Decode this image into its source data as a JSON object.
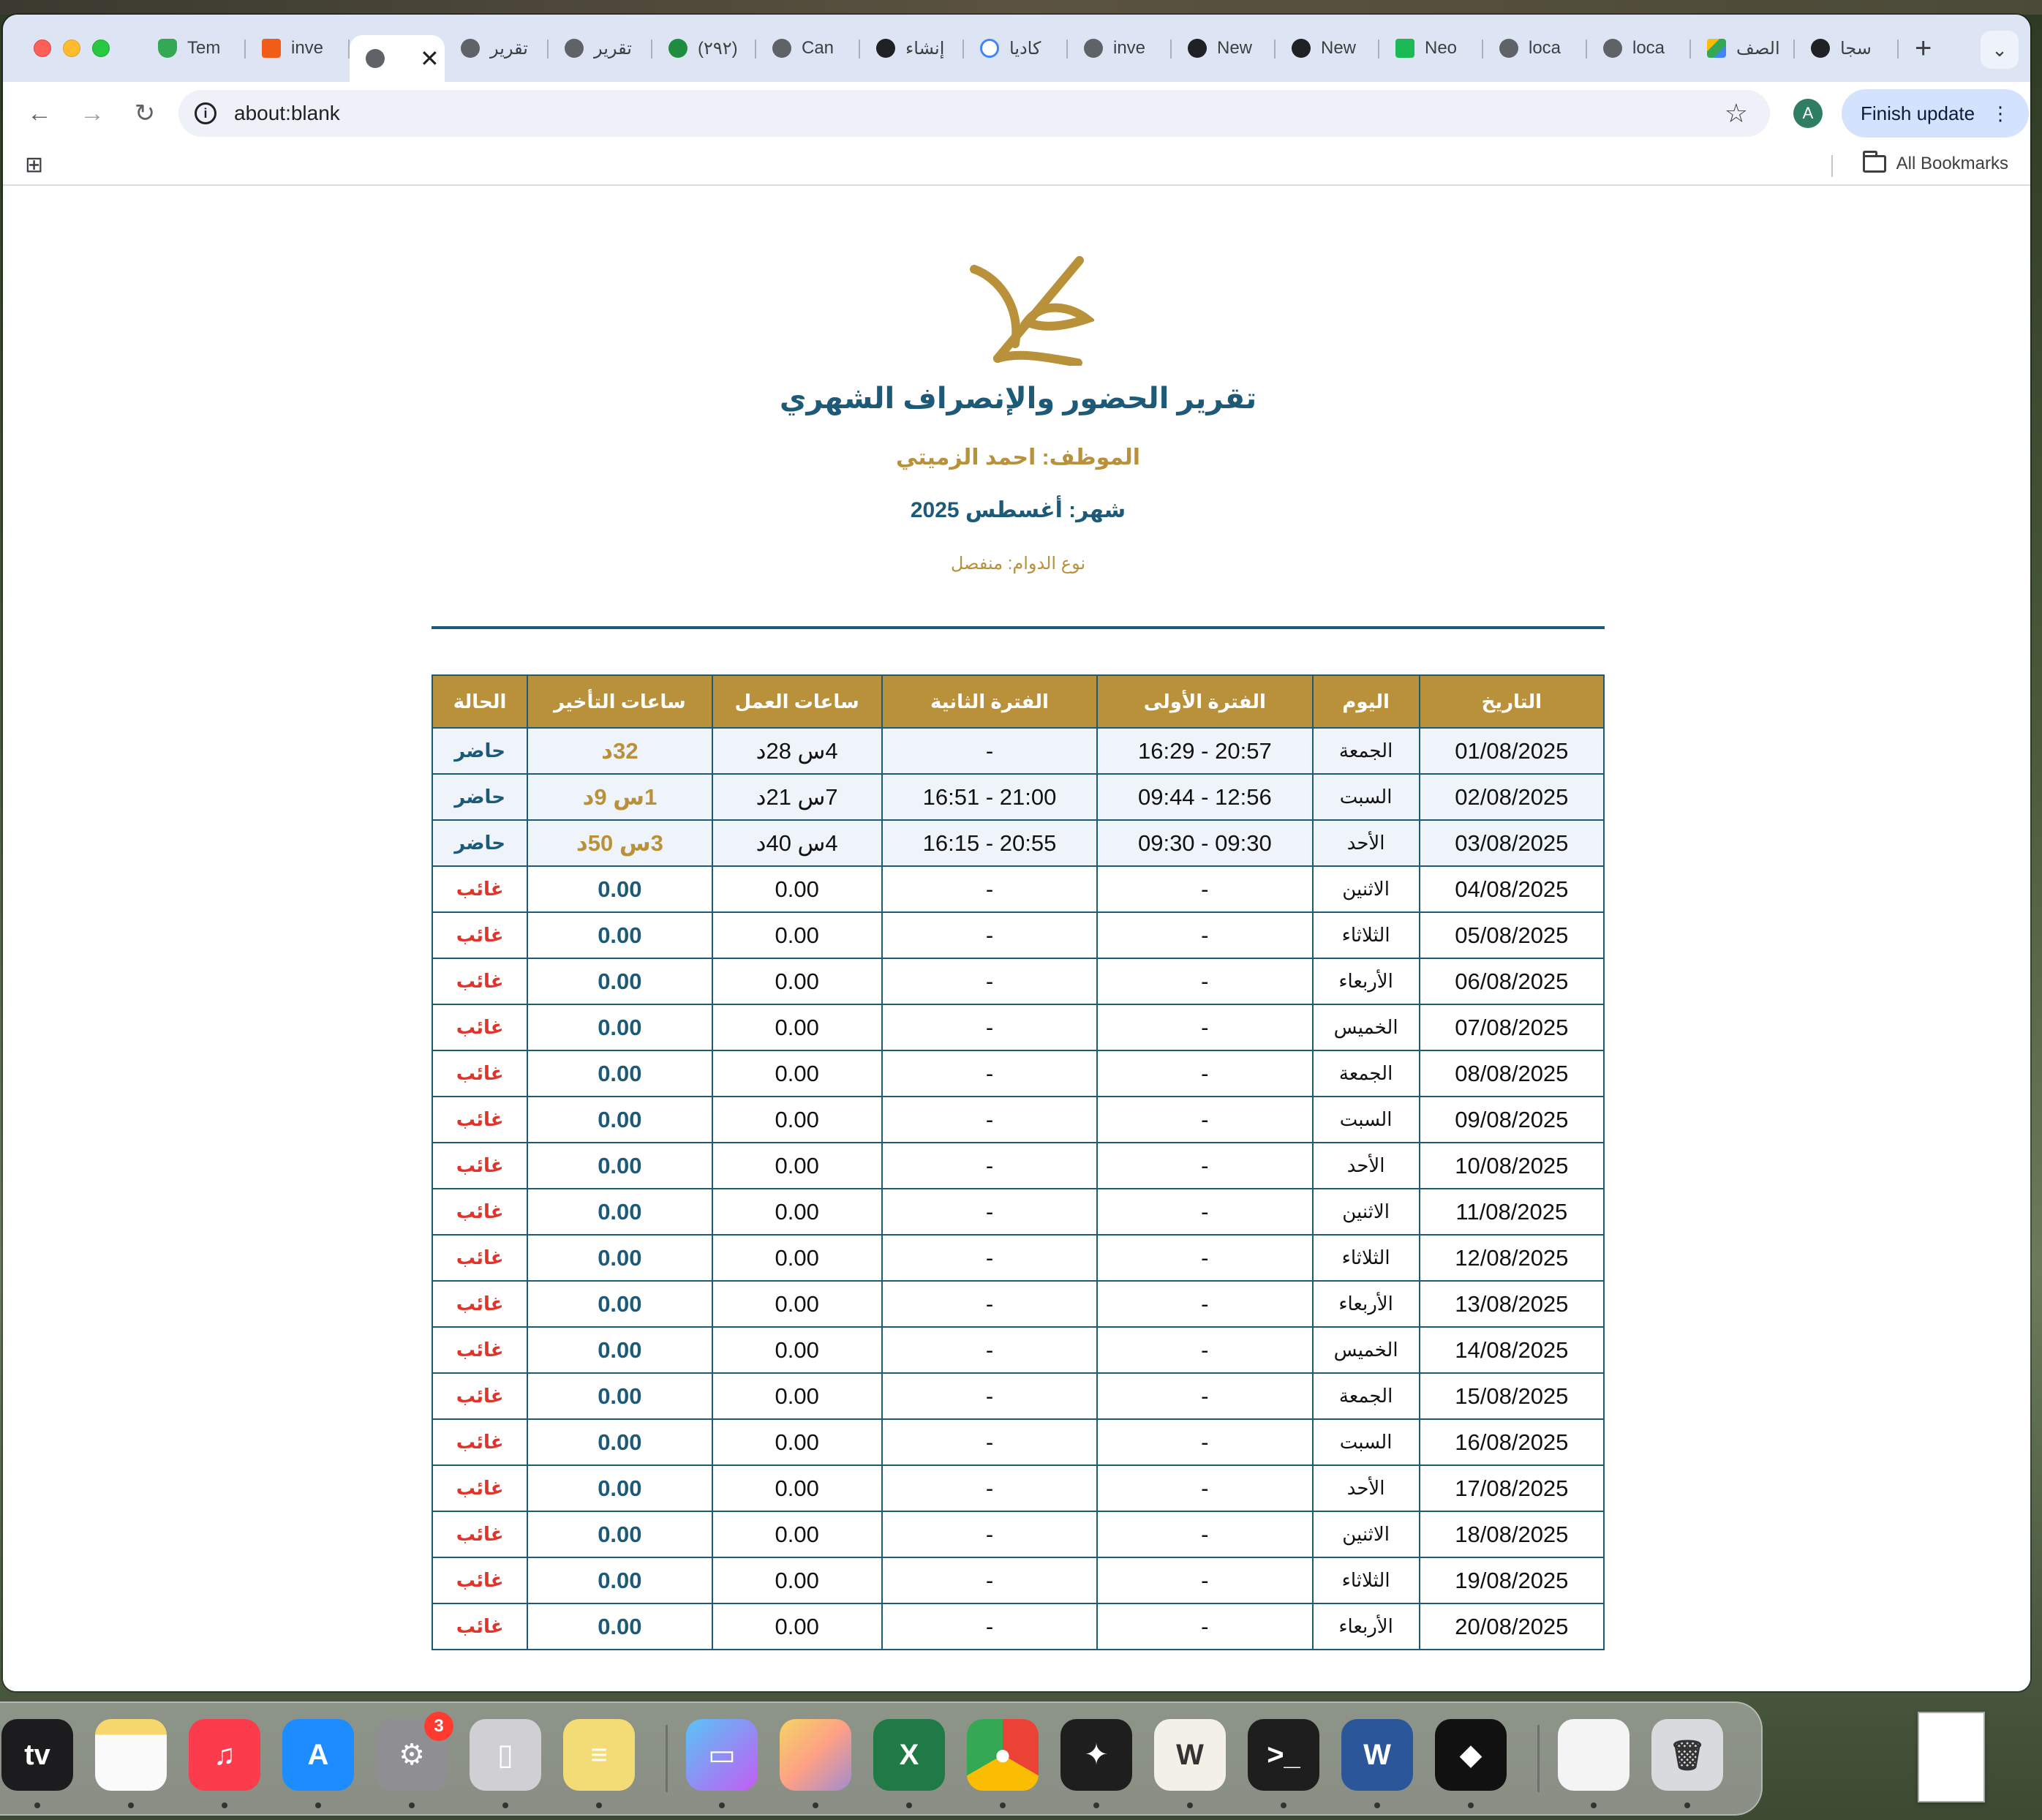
{
  "browser": {
    "tabs": [
      {
        "label": "Tem",
        "icon": "shield-check-icon"
      },
      {
        "label": "inve",
        "icon": "orange-logo-icon"
      },
      {
        "label": "",
        "icon": "globe-icon",
        "active": true
      },
      {
        "label": "تقرير",
        "icon": "globe-icon"
      },
      {
        "label": "تقرير",
        "icon": "globe-icon"
      },
      {
        "label": "(٢٩٢)",
        "icon": "green-badge-icon"
      },
      {
        "label": "Can",
        "icon": "globe-icon"
      },
      {
        "label": "إنشاء",
        "icon": "openai-icon"
      },
      {
        "label": "كاديا",
        "icon": "google-icon"
      },
      {
        "label": "inve",
        "icon": "globe-icon"
      },
      {
        "label": "New",
        "icon": "openai-icon"
      },
      {
        "label": "New",
        "icon": "openai-icon"
      },
      {
        "label": "Neo",
        "icon": "neo-icon"
      },
      {
        "label": "loca",
        "icon": "globe-icon"
      },
      {
        "label": "loca",
        "icon": "globe-icon"
      },
      {
        "label": "الصف",
        "icon": "drive-icon"
      },
      {
        "label": "سجا",
        "icon": "openai-icon"
      }
    ],
    "close_tab_glyph": "✕",
    "new_tab_glyph": "+",
    "url": "about:blank",
    "update_button": "Finish update",
    "avatar_letter": "A",
    "all_bookmarks": "All Bookmarks"
  },
  "report": {
    "title": "تقرير الحضور والإنصراف الشهري",
    "employee": "الموظف: احمد الزميتي",
    "month": "شهر: أغسطس 2025",
    "shift_type": "نوع الدوام: منفصل",
    "columns": [
      "التاريخ",
      "اليوم",
      "الفترة الأولى",
      "الفترة الثانية",
      "ساعات العمل",
      "ساعات التأخير",
      "الحالة"
    ],
    "rows": [
      {
        "date": "01/08/2025",
        "day": "الجمعة",
        "p1": "20:57 - 16:29",
        "p2": "-",
        "work": "4س 28د",
        "late": "32د",
        "status": "حاضر"
      },
      {
        "date": "02/08/2025",
        "day": "السبت",
        "p1": "12:56 - 09:44",
        "p2": "21:00 - 16:51",
        "work": "7س 21د",
        "late": "1س 9د",
        "status": "حاضر"
      },
      {
        "date": "03/08/2025",
        "day": "الأحد",
        "p1": "09:30 - 09:30",
        "p2": "20:55 - 16:15",
        "work": "4س 40د",
        "late": "3س 50د",
        "status": "حاضر"
      },
      {
        "date": "04/08/2025",
        "day": "الاثنين",
        "p1": "-",
        "p2": "-",
        "work": "0.00",
        "late": "0.00",
        "status": "غائب"
      },
      {
        "date": "05/08/2025",
        "day": "الثلاثاء",
        "p1": "-",
        "p2": "-",
        "work": "0.00",
        "late": "0.00",
        "status": "غائب"
      },
      {
        "date": "06/08/2025",
        "day": "الأربعاء",
        "p1": "-",
        "p2": "-",
        "work": "0.00",
        "late": "0.00",
        "status": "غائب"
      },
      {
        "date": "07/08/2025",
        "day": "الخميس",
        "p1": "-",
        "p2": "-",
        "work": "0.00",
        "late": "0.00",
        "status": "غائب"
      },
      {
        "date": "08/08/2025",
        "day": "الجمعة",
        "p1": "-",
        "p2": "-",
        "work": "0.00",
        "late": "0.00",
        "status": "غائب"
      },
      {
        "date": "09/08/2025",
        "day": "السبت",
        "p1": "-",
        "p2": "-",
        "work": "0.00",
        "late": "0.00",
        "status": "غائب"
      },
      {
        "date": "10/08/2025",
        "day": "الأحد",
        "p1": "-",
        "p2": "-",
        "work": "0.00",
        "late": "0.00",
        "status": "غائب"
      },
      {
        "date": "11/08/2025",
        "day": "الاثنين",
        "p1": "-",
        "p2": "-",
        "work": "0.00",
        "late": "0.00",
        "status": "غائب"
      },
      {
        "date": "12/08/2025",
        "day": "الثلاثاء",
        "p1": "-",
        "p2": "-",
        "work": "0.00",
        "late": "0.00",
        "status": "غائب"
      },
      {
        "date": "13/08/2025",
        "day": "الأربعاء",
        "p1": "-",
        "p2": "-",
        "work": "0.00",
        "late": "0.00",
        "status": "غائب"
      },
      {
        "date": "14/08/2025",
        "day": "الخميس",
        "p1": "-",
        "p2": "-",
        "work": "0.00",
        "late": "0.00",
        "status": "غائب"
      },
      {
        "date": "15/08/2025",
        "day": "الجمعة",
        "p1": "-",
        "p2": "-",
        "work": "0.00",
        "late": "0.00",
        "status": "غائب"
      },
      {
        "date": "16/08/2025",
        "day": "السبت",
        "p1": "-",
        "p2": "-",
        "work": "0.00",
        "late": "0.00",
        "status": "غائب"
      },
      {
        "date": "17/08/2025",
        "day": "الأحد",
        "p1": "-",
        "p2": "-",
        "work": "0.00",
        "late": "0.00",
        "status": "غائب"
      },
      {
        "date": "18/08/2025",
        "day": "الاثنين",
        "p1": "-",
        "p2": "-",
        "work": "0.00",
        "late": "0.00",
        "status": "غائب"
      },
      {
        "date": "19/08/2025",
        "day": "الثلاثاء",
        "p1": "-",
        "p2": "-",
        "work": "0.00",
        "late": "0.00",
        "status": "غائب"
      },
      {
        "date": "20/08/2025",
        "day": "الأربعاء",
        "p1": "-",
        "p2": "-",
        "work": "0.00",
        "late": "0.00",
        "status": "غائب"
      }
    ]
  },
  "dock": {
    "tv_label": "tv",
    "settings_badge": "3",
    "excel_letter": "X",
    "word_letter": "W",
    "apps": [
      "apple-tv-icon",
      "notes-icon",
      "music-icon",
      "app-store-icon",
      "system-settings-icon",
      "iphone-mirroring-icon",
      "stickies-icon",
      "screen-app-icon",
      "gradient-app-icon",
      "excel-icon",
      "chrome-icon",
      "figma-icon",
      "wave-app-icon",
      "terminal-icon",
      "word-icon",
      "cube-app-icon",
      "document-preview-icon",
      "trash-icon"
    ]
  },
  "colors": {
    "header_gold": "#b8913a",
    "report_blue": "#1d5a78",
    "absent_red": "#e0342b",
    "tab_bar": "#dde5f4"
  }
}
